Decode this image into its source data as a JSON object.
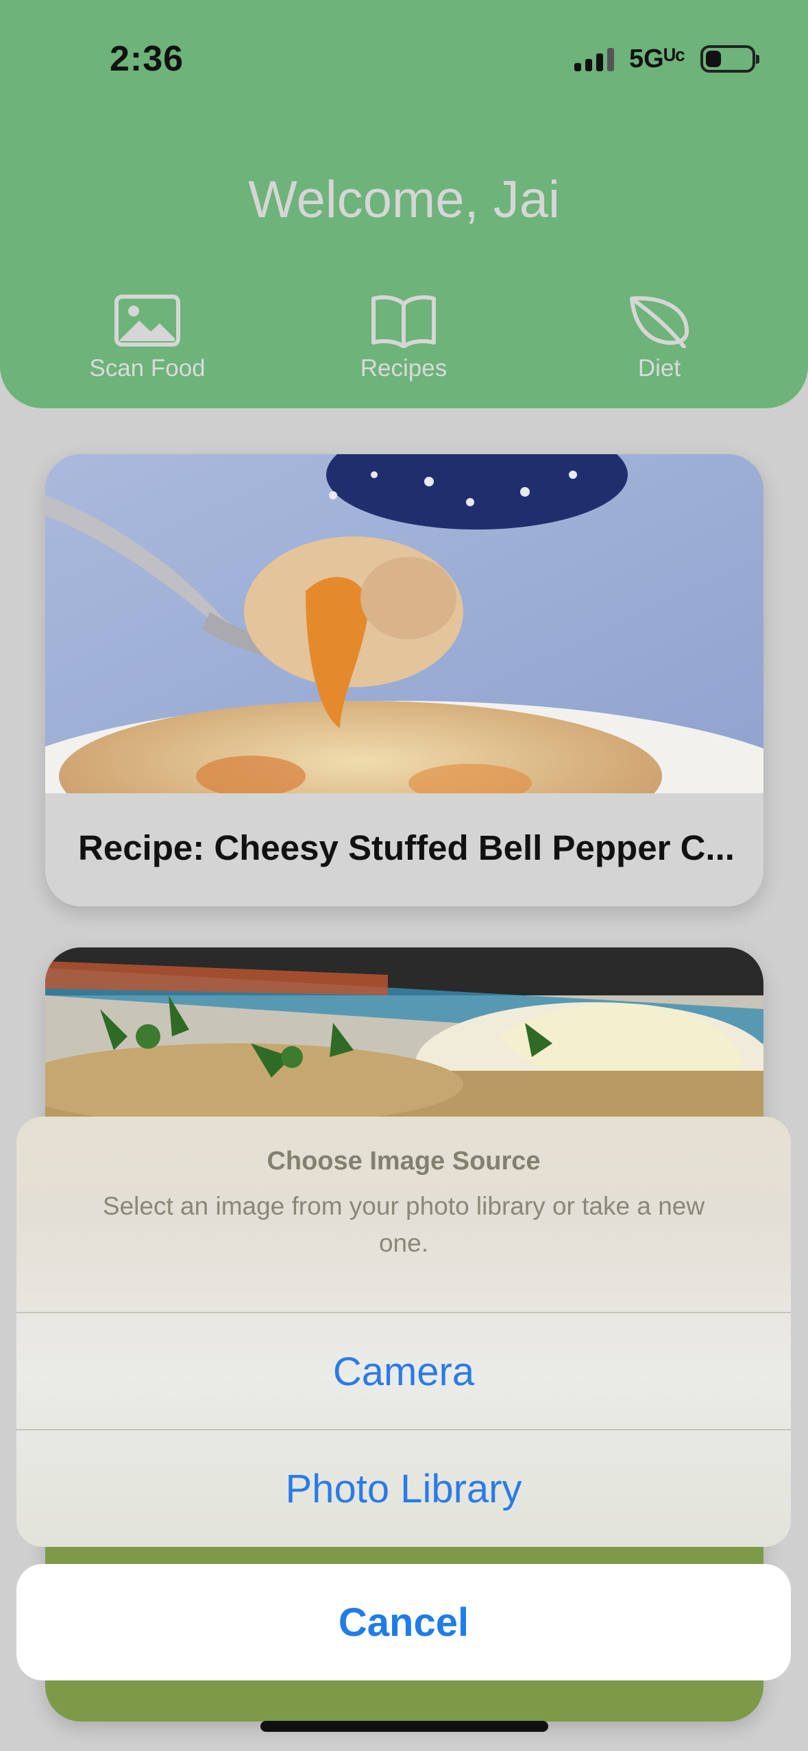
{
  "status_bar": {
    "time": "2:36",
    "network": "5Gᵁᶜ",
    "battery_level": 0.35
  },
  "header": {
    "welcome": "Welcome, Jai",
    "bg_color": "#6db37a",
    "nav": [
      {
        "label": "Scan Food",
        "icon": "photo-icon"
      },
      {
        "label": "Recipes",
        "icon": "book-icon"
      },
      {
        "label": "Diet",
        "icon": "leaf-icon"
      }
    ]
  },
  "cards": [
    {
      "title": "Recipe: Cheesy Stuffed Bell Pepper C...",
      "image": "cheesy-stuffed-pepper-photo"
    },
    {
      "title": "",
      "image": "fish-with-parsley-and-lemon-photo"
    }
  ],
  "action_sheet": {
    "title": "Choose Image Source",
    "message": "Select an image from your photo library or take a new one.",
    "buttons": [
      "Camera",
      "Photo Library"
    ],
    "cancel": "Cancel",
    "accent_color": "#2a7be6"
  }
}
